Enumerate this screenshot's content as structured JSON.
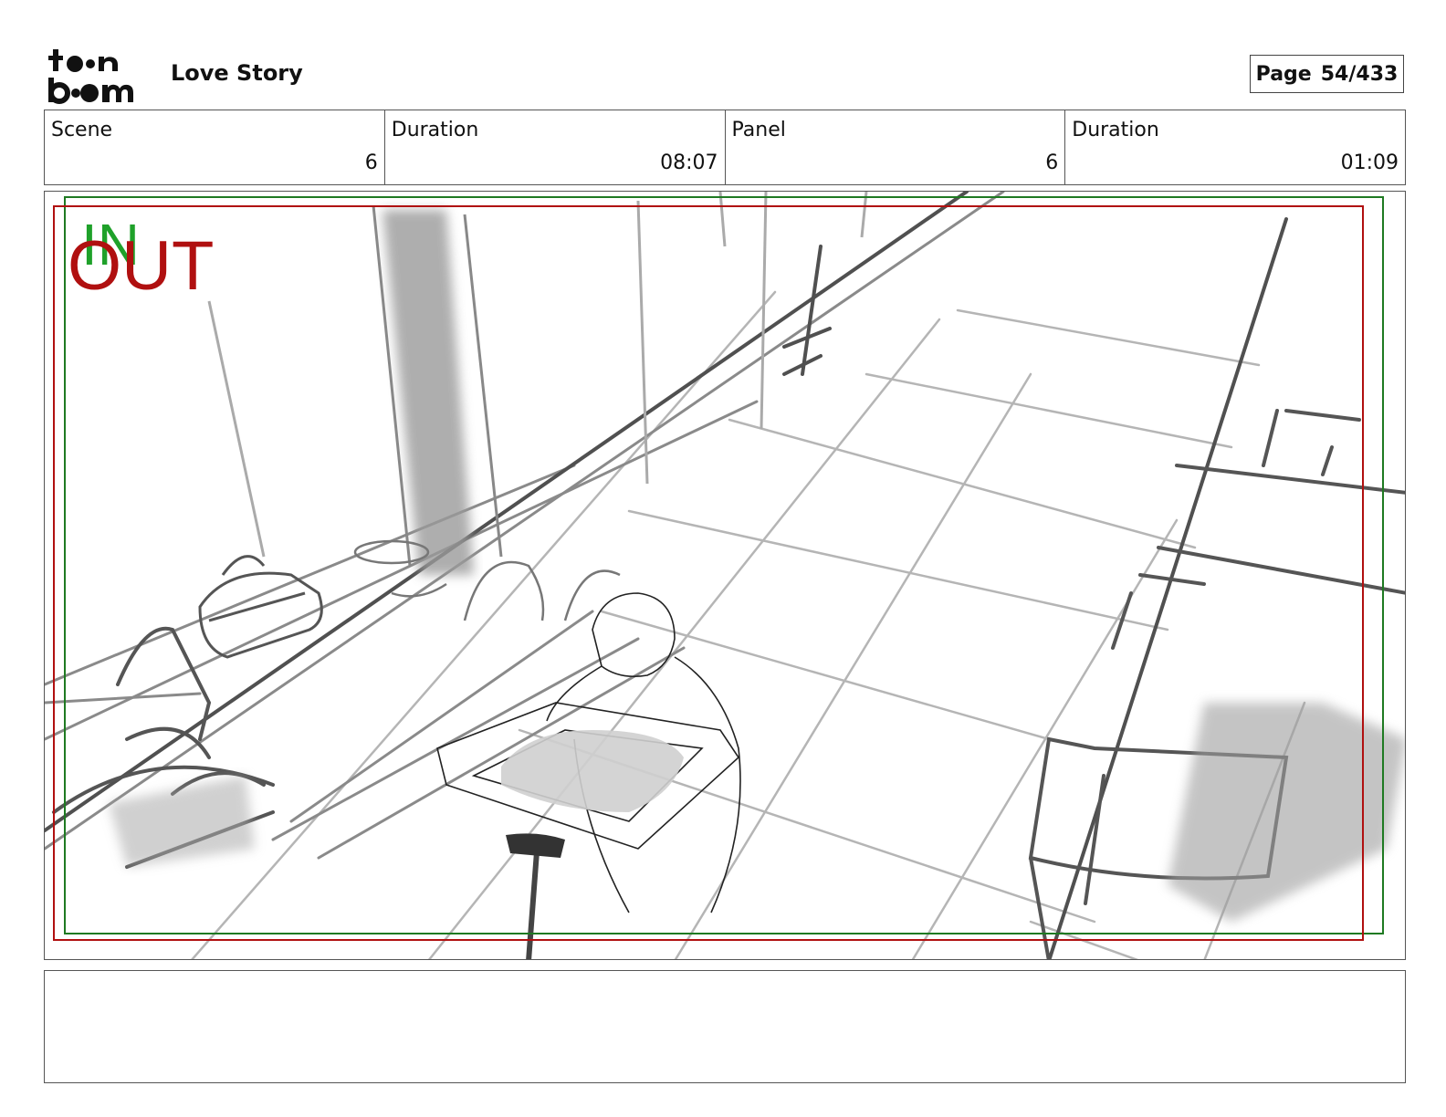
{
  "header": {
    "logo_text": "toon boom",
    "project_title": "Love Story",
    "page_label": "Page",
    "page_number": "54/433"
  },
  "info": {
    "scene_label": "Scene",
    "scene_value": "6",
    "scene_duration_label": "Duration",
    "scene_duration_value": "08:07",
    "panel_label": "Panel",
    "panel_value": "6",
    "panel_duration_label": "Duration",
    "panel_duration_value": "01:09"
  },
  "panel": {
    "in_marker": "IN",
    "out_marker": "OUT",
    "in_color": "#1fa12a",
    "out_color": "#b01010"
  },
  "notes": {
    "text": ""
  }
}
